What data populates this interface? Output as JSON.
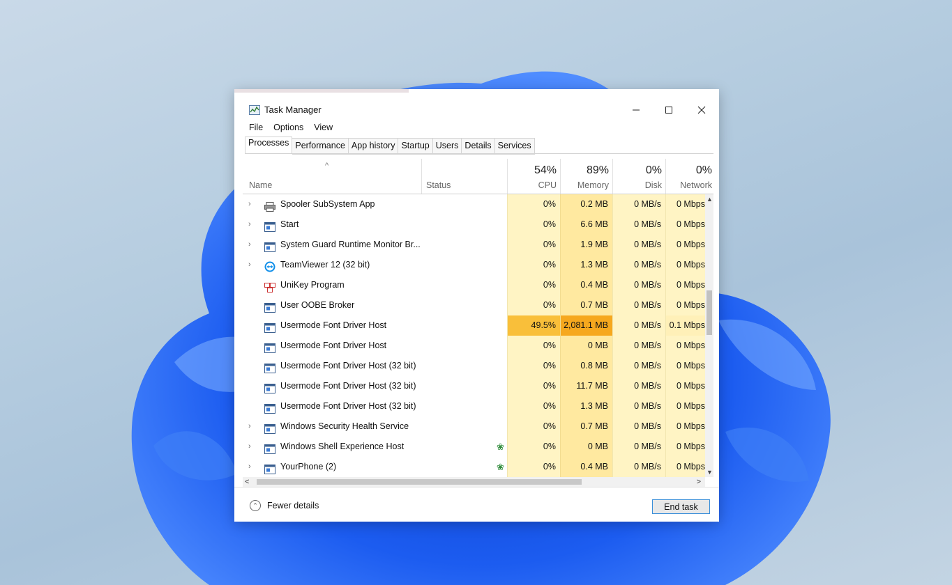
{
  "window": {
    "title": "Task Manager"
  },
  "menu": [
    "File",
    "Options",
    "View"
  ],
  "tabs": [
    "Processes",
    "Performance",
    "App history",
    "Startup",
    "Users",
    "Details",
    "Services"
  ],
  "columns": {
    "name": "Name",
    "status": "Status",
    "cpu": {
      "pct": "54%",
      "label": "CPU"
    },
    "memory": {
      "pct": "89%",
      "label": "Memory"
    },
    "disk": {
      "pct": "0%",
      "label": "Disk"
    },
    "network": {
      "pct": "0%",
      "label": "Network"
    }
  },
  "rows": [
    {
      "name": "Spooler SubSystem App",
      "expand": true,
      "icon": "printer-icon",
      "status_leaf": false,
      "cpu": "0%",
      "memory": "0.2 MB",
      "disk": "0 MB/s",
      "network": "0 Mbps"
    },
    {
      "name": "Start",
      "expand": true,
      "icon": "app-window-icon",
      "status_leaf": false,
      "cpu": "0%",
      "memory": "6.6 MB",
      "disk": "0 MB/s",
      "network": "0 Mbps"
    },
    {
      "name": "System Guard Runtime Monitor Br...",
      "expand": true,
      "icon": "app-window-icon",
      "status_leaf": false,
      "cpu": "0%",
      "memory": "1.9 MB",
      "disk": "0 MB/s",
      "network": "0 Mbps"
    },
    {
      "name": "TeamViewer 12 (32 bit)",
      "expand": true,
      "icon": "teamviewer-icon",
      "status_leaf": false,
      "cpu": "0%",
      "memory": "1.3 MB",
      "disk": "0 MB/s",
      "network": "0 Mbps"
    },
    {
      "name": "UniKey Program",
      "expand": false,
      "icon": "unikey-icon",
      "status_leaf": false,
      "cpu": "0%",
      "memory": "0.4 MB",
      "disk": "0 MB/s",
      "network": "0 Mbps"
    },
    {
      "name": "User OOBE Broker",
      "expand": false,
      "icon": "app-window-icon",
      "status_leaf": false,
      "cpu": "0%",
      "memory": "0.7 MB",
      "disk": "0 MB/s",
      "network": "0 Mbps"
    },
    {
      "name": "Usermode Font Driver Host",
      "expand": false,
      "icon": "app-window-icon",
      "status_leaf": false,
      "cpu": "49.5%",
      "memory": "2,081.1 MB",
      "disk": "0 MB/s",
      "network": "0.1 Mbps",
      "hot": true
    },
    {
      "name": "Usermode Font Driver Host",
      "expand": false,
      "icon": "app-window-icon",
      "status_leaf": false,
      "cpu": "0%",
      "memory": "0 MB",
      "disk": "0 MB/s",
      "network": "0 Mbps"
    },
    {
      "name": "Usermode Font Driver Host (32 bit)",
      "expand": false,
      "icon": "app-window-icon",
      "status_leaf": false,
      "cpu": "0%",
      "memory": "0.8 MB",
      "disk": "0 MB/s",
      "network": "0 Mbps"
    },
    {
      "name": "Usermode Font Driver Host (32 bit)",
      "expand": false,
      "icon": "app-window-icon",
      "status_leaf": false,
      "cpu": "0%",
      "memory": "11.7 MB",
      "disk": "0 MB/s",
      "network": "0 Mbps"
    },
    {
      "name": "Usermode Font Driver Host (32 bit)",
      "expand": false,
      "icon": "app-window-icon",
      "status_leaf": false,
      "cpu": "0%",
      "memory": "1.3 MB",
      "disk": "0 MB/s",
      "network": "0 Mbps"
    },
    {
      "name": "Windows Security Health Service",
      "expand": true,
      "icon": "app-window-icon",
      "status_leaf": false,
      "cpu": "0%",
      "memory": "0.7 MB",
      "disk": "0 MB/s",
      "network": "0 Mbps"
    },
    {
      "name": "Windows Shell Experience Host",
      "expand": true,
      "icon": "app-window-icon",
      "status_leaf": true,
      "cpu": "0%",
      "memory": "0 MB",
      "disk": "0 MB/s",
      "network": "0 Mbps"
    },
    {
      "name": "YourPhone (2)",
      "expand": true,
      "icon": "app-window-icon",
      "status_leaf": true,
      "cpu": "0%",
      "memory": "0.4 MB",
      "disk": "0 MB/s",
      "network": "0 Mbps"
    }
  ],
  "footer": {
    "fewer_details": "Fewer details",
    "end_task": "End task"
  }
}
